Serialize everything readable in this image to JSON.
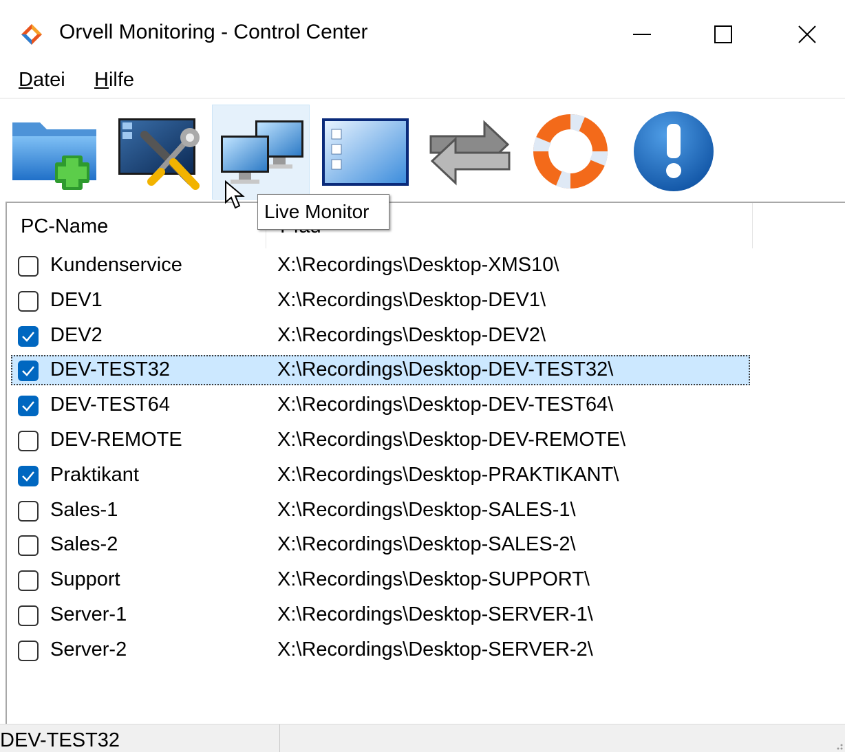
{
  "window": {
    "title": "Orvell Monitoring - Control Center"
  },
  "menu": {
    "datei": {
      "underline": "D",
      "rest": "atei"
    },
    "hilfe": {
      "underline": "H",
      "rest": "ilfe"
    }
  },
  "toolbar": {
    "icons": [
      "add-folder-icon",
      "settings-tools-icon",
      "live-monitor-icon",
      "window-list-icon",
      "refresh-icon",
      "help-lifebuoy-icon",
      "info-icon"
    ],
    "tooltip": "Live Monitor"
  },
  "list": {
    "columns": {
      "pc_name": "PC-Name",
      "path": "Pfad"
    },
    "rows": [
      {
        "name": "Kundenservice",
        "path": "X:\\Recordings\\Desktop-XMS10\\",
        "checked": false
      },
      {
        "name": "DEV1",
        "path": "X:\\Recordings\\Desktop-DEV1\\",
        "checked": false
      },
      {
        "name": "DEV2",
        "path": "X:\\Recordings\\Desktop-DEV2\\",
        "checked": true
      },
      {
        "name": "DEV-TEST32",
        "path": "X:\\Recordings\\Desktop-DEV-TEST32\\",
        "checked": true,
        "selected": true
      },
      {
        "name": "DEV-TEST64",
        "path": "X:\\Recordings\\Desktop-DEV-TEST64\\",
        "checked": true
      },
      {
        "name": "DEV-REMOTE",
        "path": "X:\\Recordings\\Desktop-DEV-REMOTE\\",
        "checked": false
      },
      {
        "name": "Praktikant",
        "path": "X:\\Recordings\\Desktop-PRAKTIKANT\\",
        "checked": true
      },
      {
        "name": "Sales-1",
        "path": "X:\\Recordings\\Desktop-SALES-1\\",
        "checked": false
      },
      {
        "name": "Sales-2",
        "path": "X:\\Recordings\\Desktop-SALES-2\\",
        "checked": false
      },
      {
        "name": "Support",
        "path": "X:\\Recordings\\Desktop-SUPPORT\\",
        "checked": false
      },
      {
        "name": "Server-1",
        "path": "X:\\Recordings\\Desktop-SERVER-1\\",
        "checked": false
      },
      {
        "name": "Server-2",
        "path": "X:\\Recordings\\Desktop-SERVER-2\\",
        "checked": false
      }
    ]
  },
  "status": {
    "selected": "DEV-TEST32"
  },
  "colors": {
    "accent": "#0067c0",
    "selection": "#cce8ff",
    "hover": "#e5f1fb"
  }
}
